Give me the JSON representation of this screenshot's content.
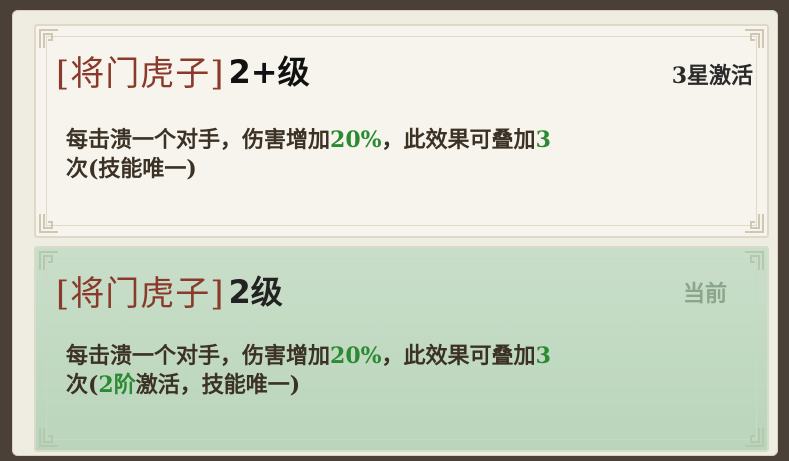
{
  "colors": {
    "skill_name": "#8a3a2a",
    "highlight": "#2b8a32",
    "current_label": "#8aa58a",
    "active_card_bg": "#bad5bb"
  },
  "cards": [
    {
      "skill_name": "[将门虎子]",
      "level": "2+级",
      "status": "3星激活",
      "desc_line1_a": "每击溃一个对手，伤害增加",
      "desc_line1_pct": "20%",
      "desc_line1_b": "，此效果可叠加",
      "desc_line1_num": "3",
      "desc_line2": "次(技能唯一)"
    },
    {
      "skill_name": "[将门虎子]",
      "level": "2级",
      "status": "当前",
      "desc_line1_a": "每击溃一个对手，伤害增加",
      "desc_line1_pct": "20%",
      "desc_line1_b": "，此效果可叠加",
      "desc_line1_num": "3",
      "desc_line2_a": "次(",
      "desc_line2_hl": "2阶",
      "desc_line2_b": "激活，技能唯一)"
    }
  ]
}
